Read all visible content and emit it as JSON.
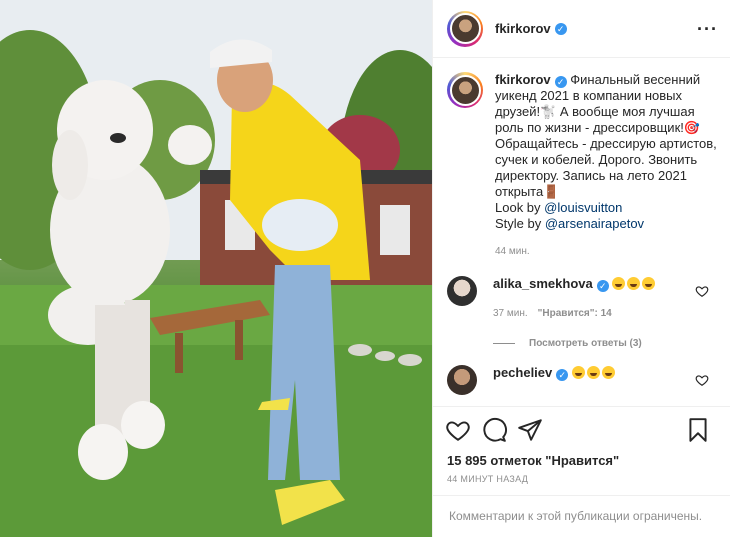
{
  "post": {
    "username": "fkirkorov",
    "verified_icon": "verified-badge-icon",
    "more_icon": "more-options-icon"
  },
  "caption": {
    "username": "fkirkorov",
    "text": " Финальный весенний уикенд 2021 в компании новых друзей!🐩 А вообще моя лучшая роль по жизни - дрессировщик!🎯 Обращайтесь - дрессирую артистов, сучек и кобелей. Дорого. Звонить директору. Запись на лето 2021 открыта🚪",
    "look_label": "Look by ",
    "look_link": "@louisvuitton",
    "style_label": "Style by ",
    "style_link": "@arsenairapetov",
    "time": "44 мин."
  },
  "comments": [
    {
      "username": "alika_smekhova",
      "time": "37 мин.",
      "likes": "\"Нравится\": 14",
      "replies": "Посмотреть ответы (3)"
    },
    {
      "username": "pecheliev"
    }
  ],
  "actions": {
    "like_icon": "heart-icon",
    "comment_icon": "comment-icon",
    "share_icon": "share-icon",
    "save_icon": "bookmark-icon"
  },
  "likes_text": "15 895 отметок \"Нравится\"",
  "date_text": "44 МИНУТ НАЗАД",
  "comments_restricted": "Комментарии к этой публикации ограничены."
}
